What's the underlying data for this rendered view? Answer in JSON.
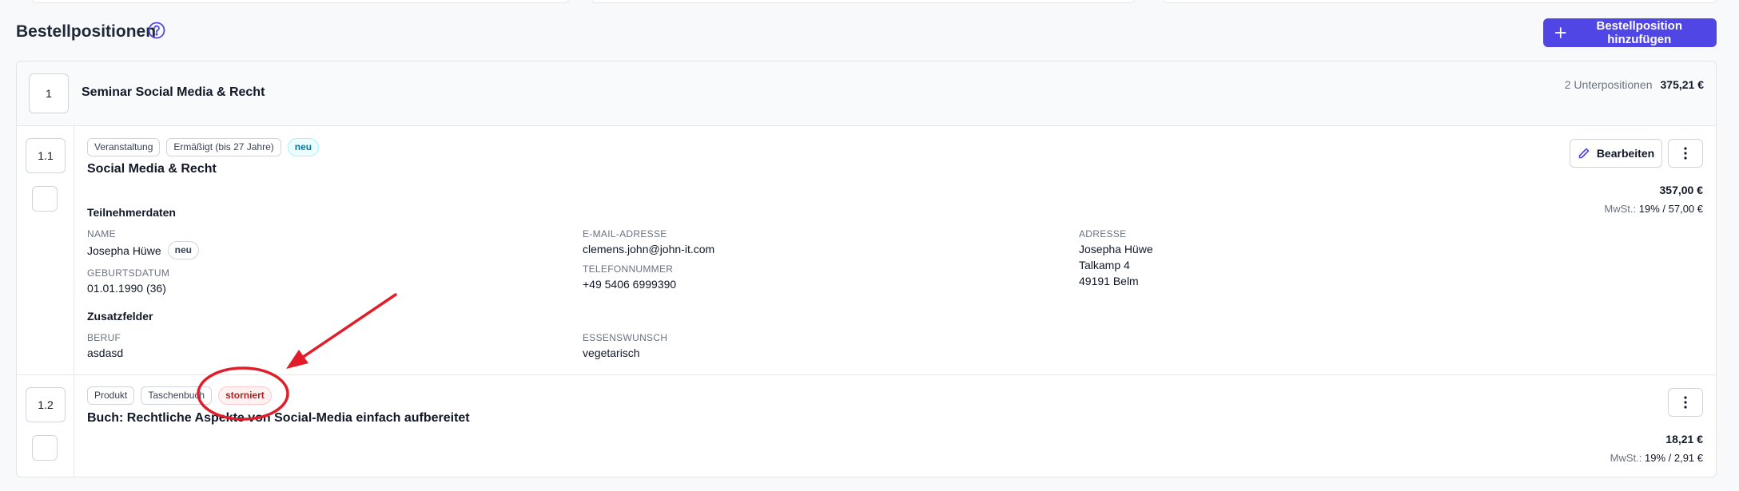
{
  "header": {
    "title": "Bestellpositionen",
    "add_button_label": "Bestellposition hinzufügen"
  },
  "group": {
    "number": "1",
    "title": "Seminar Social Media & Recht",
    "subcount": "2 Unterpositionen",
    "total": "375,21 €"
  },
  "item1": {
    "number": "1.1",
    "tags": [
      "Veranstaltung",
      "Ermäßigt (bis 27 Jahre)",
      "neu"
    ],
    "title": "Social Media & Recht",
    "edit_label": "Bearbeiten",
    "price": "357,00 €",
    "vat_label": "MwSt.:",
    "vat_value": "19% / 57,00 €",
    "participant_section": "Teilnehmerdaten",
    "fields": {
      "name_label": "NAME",
      "name_value": "Josepha Hüwe",
      "name_badge": "neu",
      "birth_label": "GEBURTSDATUM",
      "birth_value": "01.01.1990 (36)",
      "email_label": "E-MAIL-ADRESSE",
      "email_value": "clemens.john@john-it.com",
      "phone_label": "TELEFONNUMMER",
      "phone_value": "+49 5406 6999390",
      "address_label": "ADRESSE",
      "address_line1": "Josepha Hüwe",
      "address_line2": "Talkamp 4",
      "address_line3": "49191 Belm"
    },
    "extra_section": "Zusatzfelder",
    "extra": {
      "job_label": "BERUF",
      "job_value": "asdasd",
      "meal_label": "ESSENSWUNSCH",
      "meal_value": "vegetarisch"
    }
  },
  "item2": {
    "number": "1.2",
    "tags": [
      "Produkt",
      "Taschenbuch",
      "storniert"
    ],
    "title": "Buch: Rechtliche Aspekte von Social-Media einfach aufbereitet",
    "price": "18,21 €",
    "vat_label": "MwSt.:",
    "vat_value": "19% / 2,91 €"
  },
  "colors": {
    "primary": "#4f46e5",
    "annotation": "#e11d2a",
    "cancelled": "#b91c1c"
  }
}
